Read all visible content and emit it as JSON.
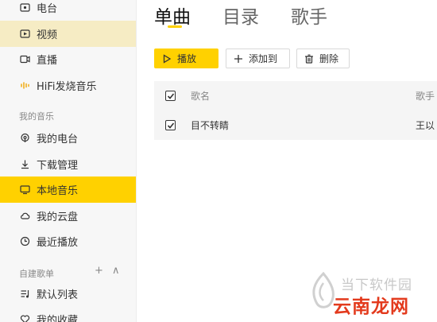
{
  "sidebar": {
    "items": [
      {
        "label": "电台",
        "icon": "radio-icon"
      },
      {
        "label": "视频",
        "icon": "video-icon"
      },
      {
        "label": "直播",
        "icon": "live-icon"
      },
      {
        "label": "HiFi发烧音乐",
        "icon": "hifi-wave-icon"
      }
    ],
    "my_music_header": "我的音乐",
    "my_music_items": [
      {
        "label": "我的电台",
        "icon": "podcast-icon"
      },
      {
        "label": "下载管理",
        "icon": "download-icon"
      },
      {
        "label": "本地音乐",
        "icon": "monitor-icon"
      },
      {
        "label": "我的云盘",
        "icon": "cloud-icon"
      },
      {
        "label": "最近播放",
        "icon": "clock-icon"
      }
    ],
    "playlists_header": "自建歌单",
    "playlists_add": "+",
    "playlists_collapse": "∧",
    "playlists": [
      {
        "label": "默认列表",
        "icon": "playlist-icon"
      },
      {
        "label": "我的收藏",
        "icon": "heart-icon"
      }
    ]
  },
  "main": {
    "tabs": [
      {
        "label": "单曲",
        "active": true
      },
      {
        "label": "目录",
        "active": false
      },
      {
        "label": "歌手",
        "active": false
      }
    ],
    "toolbar": {
      "play": "播放",
      "add_to": "添加到",
      "delete": "删除"
    },
    "table": {
      "headers": {
        "name": "歌名",
        "artist": "歌手"
      },
      "rows": [
        {
          "name": "目不转睛",
          "artist": "王以",
          "checked": true
        }
      ]
    }
  },
  "watermark": {
    "line1": "当下软件园",
    "line2": "云南龙网"
  },
  "colors": {
    "accent": "#ffd100",
    "active_tint": "#f6ecc4",
    "watermark_red": "#e33a1d"
  }
}
